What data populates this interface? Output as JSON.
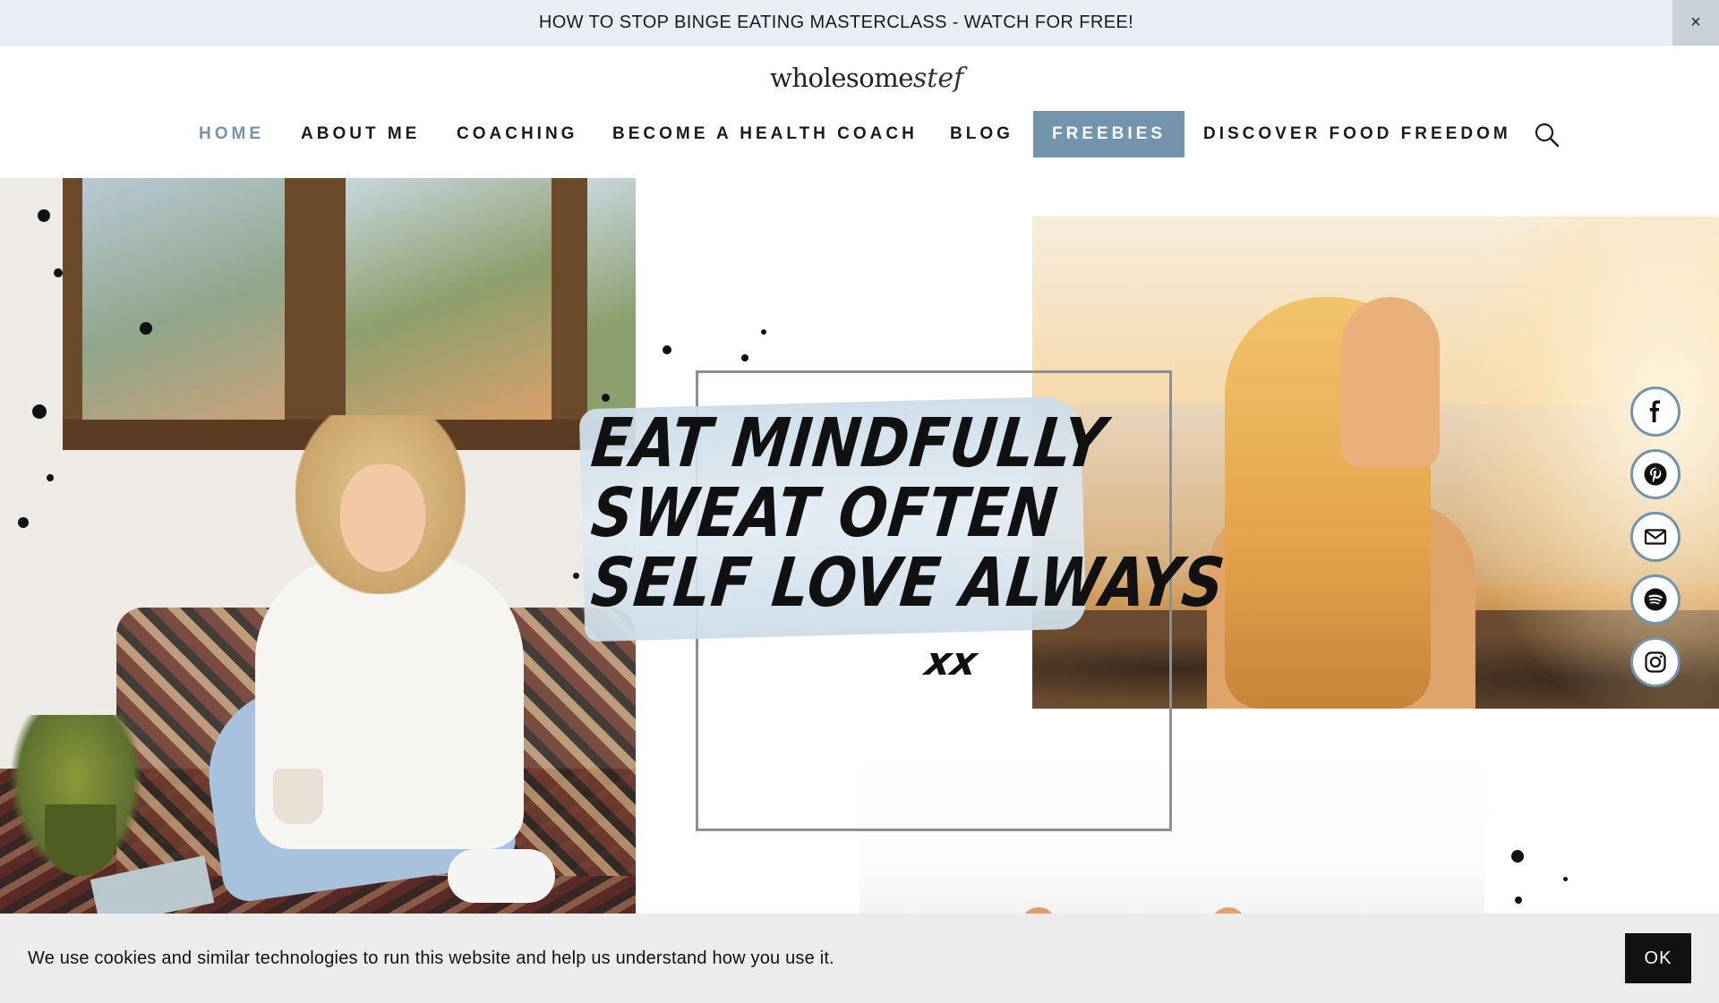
{
  "announcement": {
    "text": "HOW TO STOP BINGE EATING MASTERCLASS - WATCH FOR FREE!",
    "close_label": "×"
  },
  "logo": {
    "main": "wholesome",
    "script": "stef"
  },
  "nav": {
    "items": [
      {
        "label": "HOME",
        "state": "active"
      },
      {
        "label": "ABOUT ME"
      },
      {
        "label": "COACHING"
      },
      {
        "label": "BECOME A HEALTH COACH"
      },
      {
        "label": "BLOG"
      },
      {
        "label": "FREEBIES",
        "state": "highlighted"
      },
      {
        "label": "DISCOVER FOOD FREEDOM"
      }
    ],
    "search_icon": "search-icon"
  },
  "hero": {
    "quote_lines": [
      "EAT MINDFULLY",
      "SWEAT OFTEN",
      "SELF LOVE ALWAYS"
    ],
    "signature": "xx"
  },
  "social": {
    "icons": [
      "facebook-icon",
      "pinterest-icon",
      "email-icon",
      "spotify-icon",
      "instagram-icon"
    ]
  },
  "cookie": {
    "message": "We use cookies and similar technologies to run this website and help us understand how you use it.",
    "ok_label": "OK"
  },
  "colors": {
    "accent": "#7394ad",
    "announcement_bg": "#e9eef5",
    "cookie_bg": "#ececec",
    "button_dark": "#111111"
  }
}
